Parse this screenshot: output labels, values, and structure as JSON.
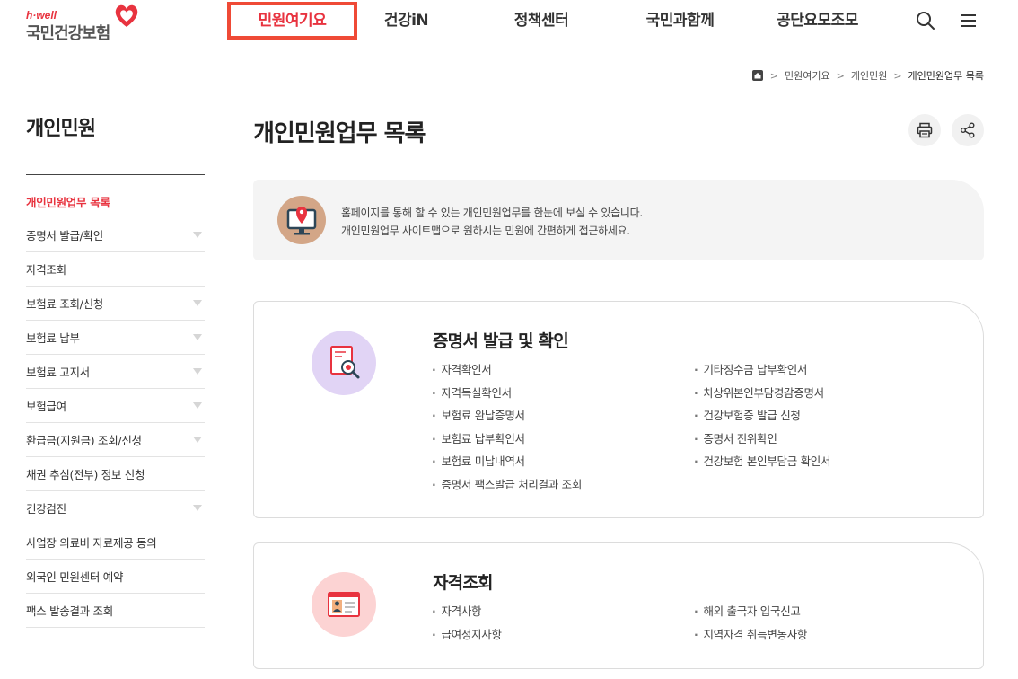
{
  "header": {
    "logo_small": "h·well",
    "logo_name": "국민건강보험",
    "nav": [
      "민원여기요",
      "건강iN",
      "정책센터",
      "국민과함께",
      "공단요모조모"
    ],
    "active_nav": "민원여기요"
  },
  "breadcrumb": [
    "민원여기요",
    "개인민원",
    "개인민원업무 목록"
  ],
  "sidebar": {
    "title": "개인민원",
    "items": [
      {
        "label": "개인민원업무 목록",
        "active": true,
        "has_sub": false
      },
      {
        "label": "증명서 발급/확인",
        "active": false,
        "has_sub": true
      },
      {
        "label": "자격조회",
        "active": false,
        "has_sub": false
      },
      {
        "label": "보험료 조회/신청",
        "active": false,
        "has_sub": true
      },
      {
        "label": "보험료 납부",
        "active": false,
        "has_sub": true
      },
      {
        "label": "보험료 고지서",
        "active": false,
        "has_sub": true
      },
      {
        "label": "보험급여",
        "active": false,
        "has_sub": true
      },
      {
        "label": "환급금(지원금) 조회/신청",
        "active": false,
        "has_sub": true
      },
      {
        "label": "채권 추심(전부) 정보 신청",
        "active": false,
        "has_sub": false
      },
      {
        "label": "건강검진",
        "active": false,
        "has_sub": true
      },
      {
        "label": "사업장 의료비 자료제공 동의",
        "active": false,
        "has_sub": false
      },
      {
        "label": "외국인 민원센터 예약",
        "active": false,
        "has_sub": false
      },
      {
        "label": "팩스 발송결과 조회",
        "active": false,
        "has_sub": false
      }
    ]
  },
  "main": {
    "title": "개인민원업무 목록",
    "intro_line1": "홈페이지를 통해 할 수 있는 개인민원업무를 한눈에 보실 수 있습니다.",
    "intro_line2": "개인민원업무 사이트맵으로 원하시는 민원에 간편하게 접근하세요.",
    "cards": [
      {
        "title": "증명서 발급 및 확인",
        "left": [
          "자격확인서",
          "자격득실확인서",
          "보험료 완납증명서",
          "보험료 납부확인서",
          "보험료 미납내역서",
          "증명서 팩스발급 처리결과 조회"
        ],
        "right": [
          "기타징수금 납부확인서",
          "차상위본인부담경감증명서",
          "건강보험증 발급 신청",
          "증명서 진위확인",
          "건강보험 본인부담금 확인서"
        ]
      },
      {
        "title": "자격조회",
        "left": [
          "자격사항",
          "급여정지사항"
        ],
        "right": [
          "해외 출국자 입국신고",
          "지역자격 취득변동사항"
        ]
      }
    ]
  },
  "colors": {
    "accent": "#e8333f",
    "card1_icon_bg": "#e1d4f5",
    "card2_icon_bg": "#fcd3d3",
    "intro_icon_bg": "#d3a687"
  }
}
